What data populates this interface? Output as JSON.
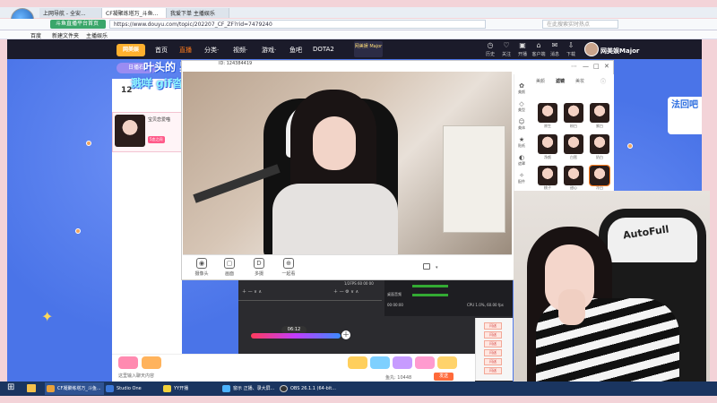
{
  "browser": {
    "tabs": [
      {
        "label": "上网导航 - 全安..."
      },
      {
        "label": "CF凝聚练塔万_斗鱼..."
      },
      {
        "label": "我爱下单 主播娱乐"
      }
    ],
    "badge": "斗鱼直播平台首页",
    "address": "https://www.douyu.com/topic/202207_CF_ZF?rid=7479240",
    "search_placeholder": "在此搜索实时热点",
    "bookmarks": [
      "百度",
      "新建文件夹",
      "主播娱乐"
    ]
  },
  "site": {
    "logo": "网美娱Major",
    "nav": [
      "首页",
      "直播",
      "分类·",
      "视频·",
      "游戏·",
      "鱼吧",
      "DOTA2"
    ],
    "active_nav": "直播",
    "promo": "网美娱 Major",
    "header_actions": [
      "历史",
      "关注",
      "开播",
      "客户端",
      "消息",
      "下载"
    ],
    "right_logo": "网美娱Major",
    "right_banner": "法回吧"
  },
  "overlay": {
    "line1": "叶头的 异形回归",
    "line2": "溅咩 gif沓 黑从根欧",
    "chip": "日播石",
    "left_count": "12"
  },
  "room_card": {
    "name": "宝贝恋爱喵",
    "tag": "5恋之间"
  },
  "player": {
    "id_text": "ID: 124384419",
    "controls": [
      "摄像头",
      "画面",
      "多摄",
      "一起看"
    ],
    "window_buttons": [
      "⋯",
      "—",
      "□",
      "✕"
    ]
  },
  "beauty_panel": {
    "tabs": [
      "美颜",
      "滤镜",
      "美妆"
    ],
    "active_tab": "滤镜",
    "side_items": [
      "美颜",
      "美型",
      "美体",
      "贴纸",
      "遮罩",
      "配件"
    ],
    "filters": [
      "原生",
      "粉白",
      "蜜白",
      "净颜",
      "白皙",
      "奶白",
      "桃子",
      "甜心",
      "冷白"
    ]
  },
  "obs": {
    "timer": "06:12",
    "stats_label": "1/2FPS 60 00 00",
    "cpu": "CPU 1.0%, 60.00 fps",
    "mic_label": "桌面音频",
    "time": "00:00:00"
  },
  "gift_bar": {
    "chat_placeholder": "这里输入聊天内容",
    "send": "发送",
    "stat": "鱼丸: 10448"
  },
  "right_list": [
    "闪送",
    "闪送",
    "闪送",
    "闪送",
    "闪送",
    "闪送"
  ],
  "webcam": {
    "brand": "AutoFull"
  },
  "taskbar": {
    "items": [
      {
        "label": "CF凝聚练塔万_斗鱼..."
      },
      {
        "label": "Studio One"
      },
      {
        "label": "YY开播"
      },
      {
        "label": "窗示 正播、录大屏..."
      },
      {
        "label": "OBS 26.1.1 (64-bit..."
      }
    ]
  },
  "colors": {
    "accent": "#ff7a1b",
    "page_bg": "#4a74e8",
    "taskbar": "#1a3560"
  }
}
